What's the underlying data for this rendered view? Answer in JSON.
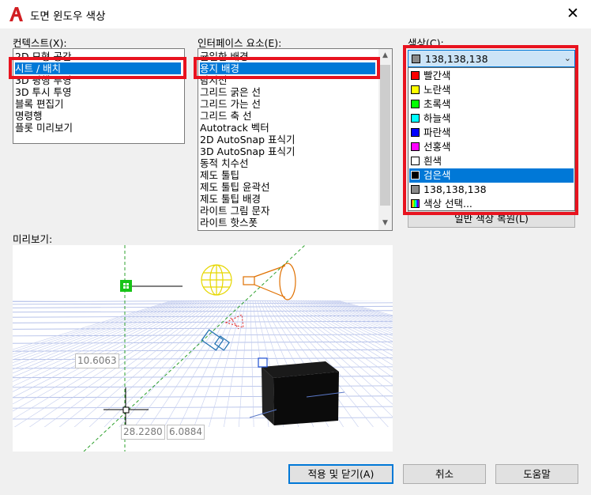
{
  "window": {
    "title": "도면 윈도우 색상",
    "close": "✕"
  },
  "context": {
    "label": "컨텍스트(X):",
    "items": [
      "2D 모형 공간",
      "시트 / 배치",
      "3D 평행 투영",
      "3D 투시 투영",
      "블록 편집기",
      "명령행",
      "플롯 미리보기"
    ],
    "selected_index": 1
  },
  "interface": {
    "label": "인터페이스 요소(E):",
    "items": [
      "균일한 배경",
      "용지 배경",
      "탐지선",
      "그리드 굵은 선",
      "그리드 가는 선",
      "그리드 축 선",
      "Autotrack 벡터",
      "2D AutoSnap 표식기",
      "3D AutoSnap 표식기",
      "동적 치수선",
      "제도 툴팁",
      "제도 툴팁 윤곽선",
      "제도 툴팁 배경",
      "라이트 그림 문자",
      "라이트 핫스폿"
    ],
    "selected_index": 1
  },
  "color": {
    "label": "색상(C):",
    "current_value": "138,138,138",
    "current_swatch": "#8a8a8a",
    "options": [
      {
        "label": "빨간색",
        "swatch": "#ff0000"
      },
      {
        "label": "노란색",
        "swatch": "#ffff00"
      },
      {
        "label": "초록색",
        "swatch": "#00ff00"
      },
      {
        "label": "하늘색",
        "swatch": "#00ffff"
      },
      {
        "label": "파란색",
        "swatch": "#0000ff"
      },
      {
        "label": "선홍색",
        "swatch": "#ff00ff"
      },
      {
        "label": "흰색",
        "swatch": "#ffffff"
      },
      {
        "label": "검은색",
        "swatch": "#000000"
      },
      {
        "label": "138,138,138",
        "swatch": "#8a8a8a"
      },
      {
        "label": "색상 선택...",
        "swatch": "rainbow"
      }
    ],
    "highlighted_index": 7
  },
  "restore_button": "일반 색상 복원(L)",
  "preview": {
    "label": "미리보기:",
    "coord_y": "10.6063",
    "coord_x": "28.2280",
    "coord_z": "6.0884"
  },
  "buttons": {
    "apply_close": "적용 및 닫기(A)",
    "cancel": "취소",
    "help": "도움말"
  },
  "highlight_color": "#e8131f",
  "selection_color": "#0078d7"
}
